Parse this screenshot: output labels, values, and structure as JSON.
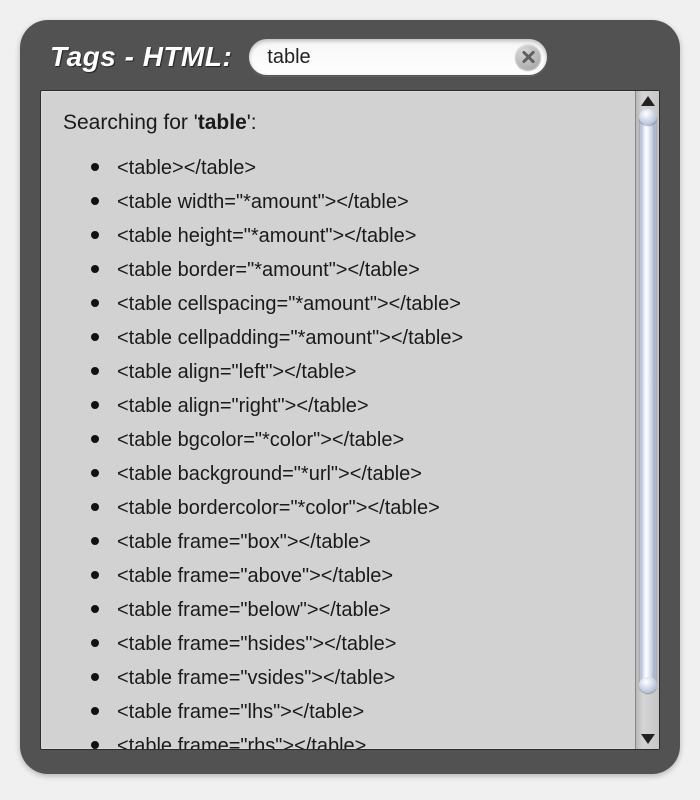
{
  "header": {
    "title": "Tags - HTML:",
    "search_value": "table",
    "clear_label": "clear"
  },
  "content": {
    "search_prefix": "Searching for '",
    "search_term": "table",
    "search_suffix": "':",
    "results": [
      "<table></table>",
      "<table width=\"*amount\"></table>",
      "<table height=\"*amount\"></table>",
      "<table border=\"*amount\"></table>",
      "<table cellspacing=\"*amount\"></table>",
      "<table cellpadding=\"*amount\"></table>",
      "<table align=\"left\"></table>",
      "<table align=\"right\"></table>",
      "<table bgcolor=\"*color\"></table>",
      "<table background=\"*url\"></table>",
      "<table bordercolor=\"*color\"></table>",
      "<table frame=\"box\"></table>",
      "<table frame=\"above\"></table>",
      "<table frame=\"below\"></table>",
      "<table frame=\"hsides\"></table>",
      "<table frame=\"vsides\"></table>",
      "<table frame=\"lhs\"></table>",
      "<table frame=\"rhs\"></table>"
    ]
  }
}
